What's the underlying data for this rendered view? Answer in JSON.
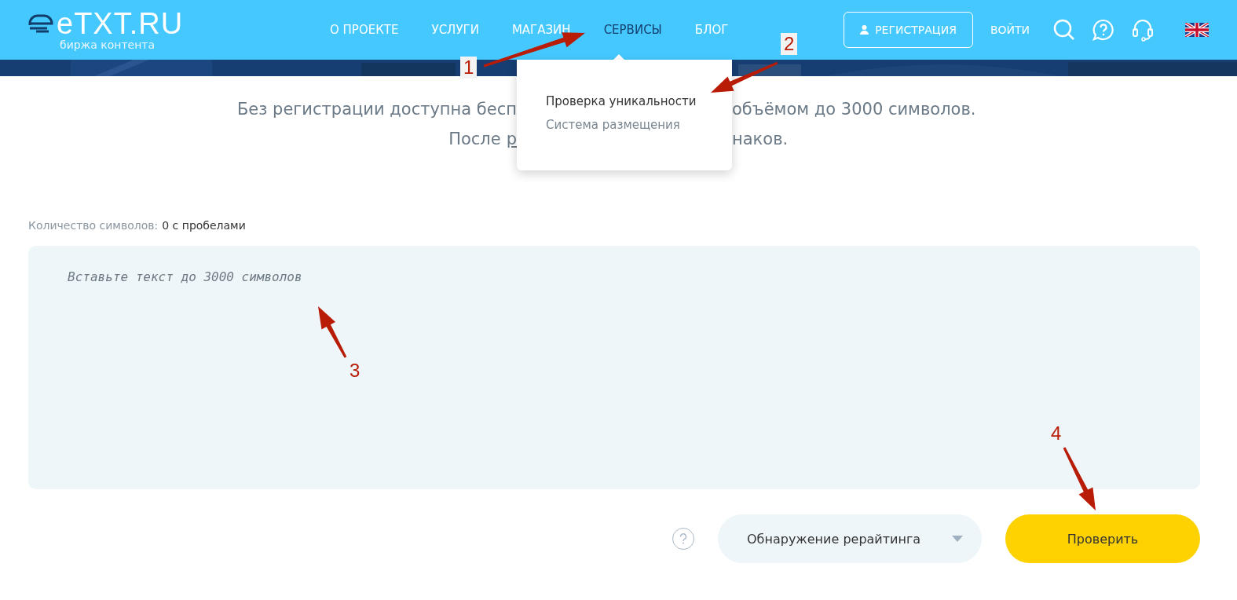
{
  "logo": {
    "name": "eTXT.RU",
    "tagline": "биржа контента"
  },
  "nav": [
    {
      "label": "О ПРОЕКТЕ",
      "selected": false
    },
    {
      "label": "УСЛУГИ",
      "selected": false
    },
    {
      "label": "МАГАЗИН",
      "selected": false
    },
    {
      "label": "СЕРВИСЫ",
      "selected": true
    },
    {
      "label": "БЛОГ",
      "selected": false
    }
  ],
  "register_button": "РЕГИСТРАЦИЯ",
  "login_link": "ВОЙТИ",
  "dropdown": {
    "items": [
      {
        "label": "Проверка уникальности",
        "selected": true
      },
      {
        "label": "Система размещения",
        "selected": false
      }
    ]
  },
  "intro": {
    "line1_left": "Без регистрации доступна бесп",
    "line1_right": "объёмом до 3000 символов.",
    "line2_left": "После",
    "line2_link": "р",
    "line2_right": "наков."
  },
  "counter": {
    "label": "Количество символов:",
    "value": "0 с пробелами"
  },
  "text_field": {
    "placeholder": "Вставьте текст до 3000 символов"
  },
  "mode_select": {
    "value": "Обнаружение рерайтинга"
  },
  "check_button": "Проверить",
  "annotations": [
    {
      "label": "1"
    },
    {
      "label": "2"
    },
    {
      "label": "3"
    },
    {
      "label": "4"
    }
  ]
}
